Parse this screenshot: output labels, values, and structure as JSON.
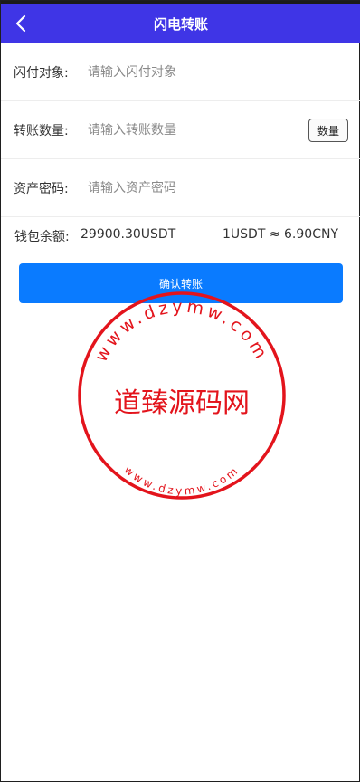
{
  "header": {
    "title": "闪电转账",
    "back_icon": "back-arrow-icon",
    "bg": "#3f35e6"
  },
  "form": {
    "target": {
      "label": "闪付对象:",
      "placeholder": "请输入闪付对象",
      "value": ""
    },
    "amount": {
      "label": "转账数量:",
      "placeholder": "请输入转账数量",
      "value": "",
      "button": "数量"
    },
    "password": {
      "label": "资产密码:",
      "placeholder": "请输入资产密码",
      "value": ""
    }
  },
  "wallet": {
    "label": "钱包余额:",
    "balance": "29900.30USDT",
    "rate": "1USDT ≈ 6.90CNY"
  },
  "confirm": {
    "label": "确认转账",
    "color": "#0a7bff"
  },
  "watermark": {
    "brand": "道臻源码网",
    "url_top": "www.dzymw.com",
    "url_bottom": "www.dzymw.com",
    "color": "#e3141c"
  }
}
